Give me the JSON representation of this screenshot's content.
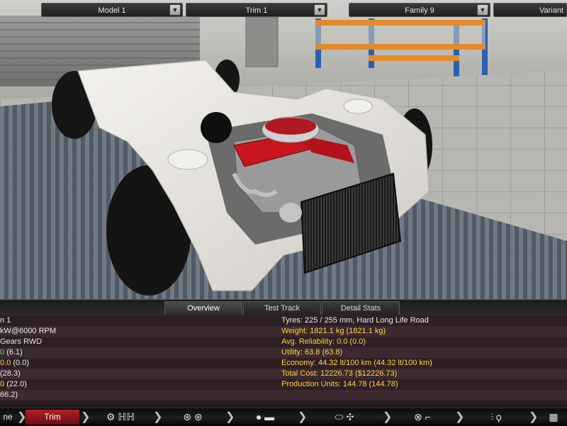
{
  "topbar": {
    "model": "Model 1",
    "trim": "Trim 1",
    "family": "Family 9",
    "variant": "Variant"
  },
  "tabs": [
    {
      "label": "Overview",
      "active": true
    },
    {
      "label": "Test Track",
      "active": false
    },
    {
      "label": "Detail Stats",
      "active": false
    }
  ],
  "stats_left": [
    {
      "text": "n 1",
      "color": "white"
    },
    {
      "text": "kW@6000 RPM",
      "color": "white"
    },
    {
      "text": "Gears RWD",
      "color": "white"
    },
    {
      "text": "(6.1)",
      "prefix": "0",
      "color": "green"
    },
    {
      "text": "(0.0)",
      "prefix": "0.0",
      "color": "yellow"
    },
    {
      "text": "(28.3)",
      "prefix": "",
      "color": "white"
    },
    {
      "text": "(22.0)",
      "prefix": "0",
      "color": "yellow"
    },
    {
      "text": "66.2)",
      "prefix": "",
      "color": "white"
    }
  ],
  "stats_right": [
    {
      "label": "Tyres:",
      "value": "225 / 255 mm, Hard Long Life Road",
      "color": "white"
    },
    {
      "label": "Weight:",
      "value": "1821.1 kg (1821.1 kg)",
      "color": "yellow"
    },
    {
      "label": "Avg. Reliability:",
      "value": "0.0 (0.0)",
      "color": "yellow"
    },
    {
      "label": "Utility:",
      "value": "63.8 (63.8)",
      "color": "yellow"
    },
    {
      "label": "Economy:",
      "value": "44.32 lt/100 km (44.32 lt/100 km)",
      "color": "yellow"
    },
    {
      "label": "Total Cost:",
      "value": "12226.73 ($12226.73)",
      "color": "yellow"
    },
    {
      "label": "Production Units:",
      "value": "144.78 (144.78)",
      "color": "yellow"
    },
    {
      "label": "",
      "value": "",
      "color": "white"
    }
  ],
  "nav": {
    "home_label": "ne",
    "trim_label": "Trim",
    "icons": [
      "engine-icon",
      "suspension-icon",
      "wheels-icon",
      "body-icon",
      "car-icon",
      "fan-icon",
      "steering-wheel-icon",
      "seat-icon",
      "shock-absorber-icon",
      "checkered-flag-icon"
    ]
  },
  "colors": {
    "accent_red": "#b11f2a",
    "stat_yellow": "#ffd23a",
    "stat_green": "#62d24a"
  }
}
